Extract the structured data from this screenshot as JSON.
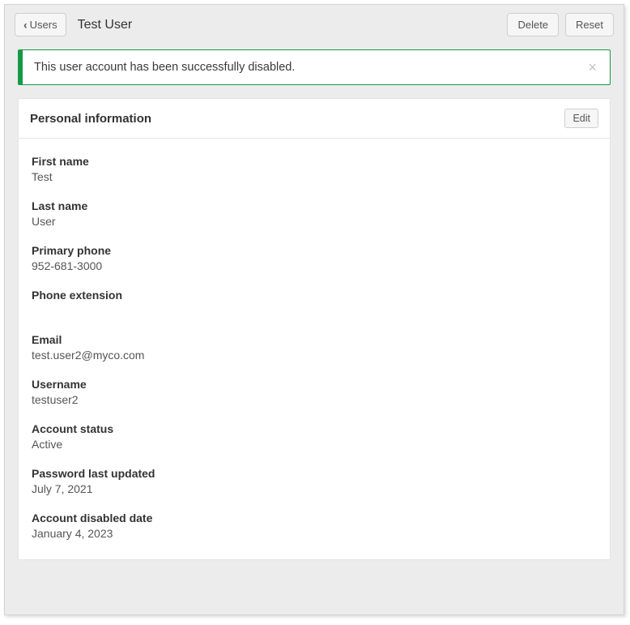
{
  "header": {
    "back_label": "Users",
    "title": "Test User",
    "delete_label": "Delete",
    "reset_label": "Reset"
  },
  "alert": {
    "message": "This user account has been successfully disabled.",
    "close_glyph": "×"
  },
  "card": {
    "title": "Personal information",
    "edit_label": "Edit"
  },
  "fields": {
    "first_name": {
      "label": "First name",
      "value": "Test"
    },
    "last_name": {
      "label": "Last name",
      "value": "User"
    },
    "primary_phone": {
      "label": "Primary phone",
      "value": "952-681-3000"
    },
    "phone_extension": {
      "label": "Phone extension",
      "value": ""
    },
    "email": {
      "label": "Email",
      "value": "test.user2@myco.com"
    },
    "username": {
      "label": "Username",
      "value": "testuser2"
    },
    "account_status": {
      "label": "Account status",
      "value": "Active"
    },
    "password_last_updated": {
      "label": "Password last updated",
      "value": "July 7, 2021"
    },
    "account_disabled_date": {
      "label": "Account disabled date",
      "value": "January 4, 2023"
    }
  }
}
